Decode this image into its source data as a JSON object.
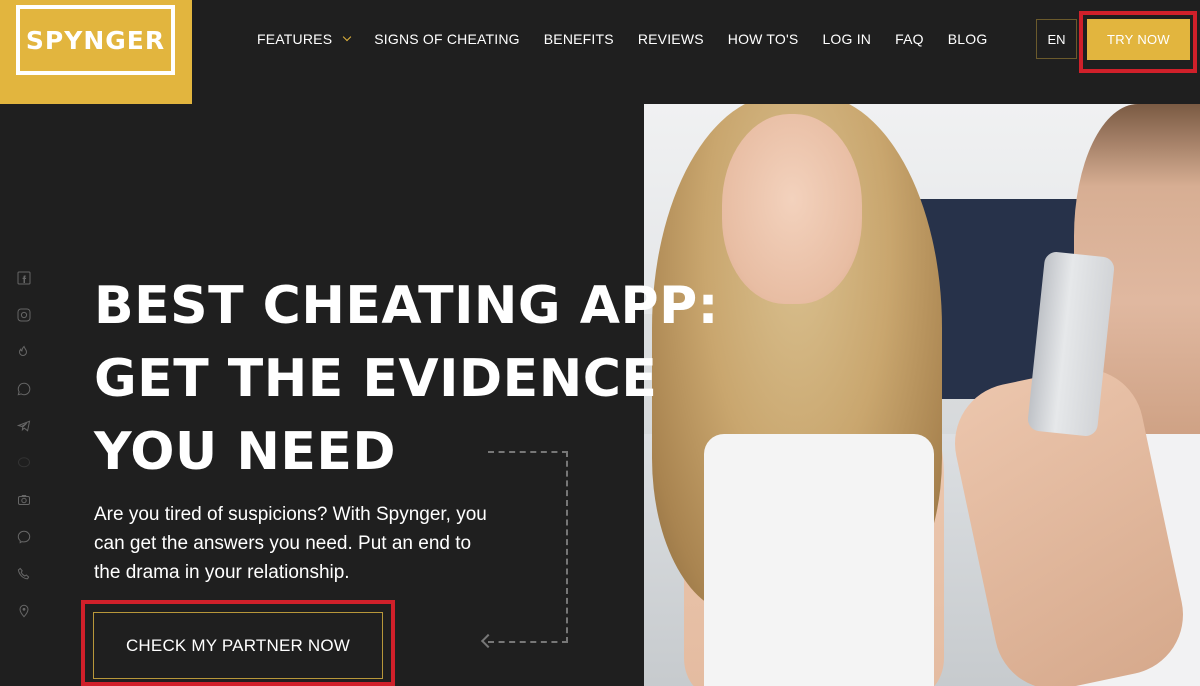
{
  "brand": {
    "logo_text": "SPYNGER",
    "accent_color": "#e2b53e",
    "highlight_color": "#d0202a"
  },
  "nav": {
    "items": [
      {
        "label": "FEATURES",
        "has_dropdown": true
      },
      {
        "label": "SIGNS OF CHEATING"
      },
      {
        "label": "BENEFITS"
      },
      {
        "label": "REVIEWS"
      },
      {
        "label": "HOW TO'S"
      },
      {
        "label": "LOG IN"
      },
      {
        "label": "FAQ"
      },
      {
        "label": "BLOG"
      }
    ],
    "language": "EN",
    "cta_label": "TRY NOW"
  },
  "social_icons": [
    "facebook-icon",
    "instagram-icon",
    "tinder-icon",
    "whatsapp-icon",
    "telegram-icon",
    "imessage-icon",
    "camera-icon",
    "messenger-icon",
    "phone-icon",
    "location-icon"
  ],
  "hero": {
    "headline_lines": [
      "BEST CHEATING APP:",
      "GET THE EVIDENCE",
      "YOU NEED"
    ],
    "subtext": "Are you tired of suspicions? With Spynger, you can get the answers you need. Put an end to the drama in your relationship.",
    "cta_label": "CHECK MY PARTNER NOW"
  }
}
